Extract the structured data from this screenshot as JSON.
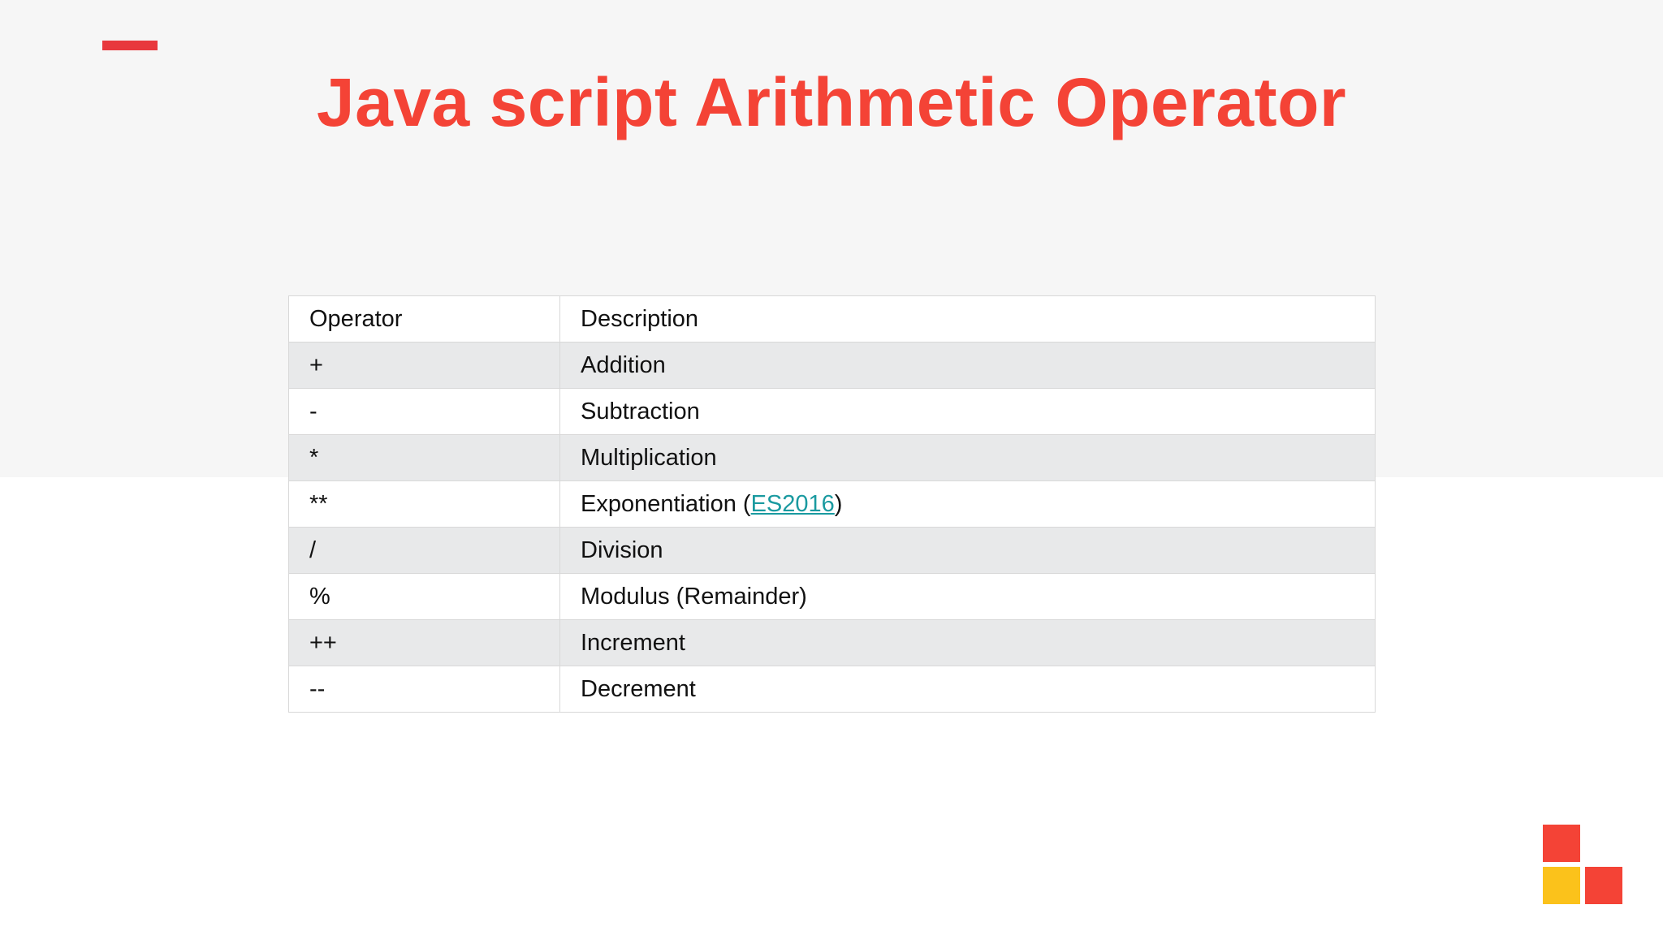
{
  "slide": {
    "title": "Java script Arithmetic Operator"
  },
  "table": {
    "headers": [
      "Operator",
      "Description"
    ],
    "rows": [
      {
        "operator": "+",
        "description": "Addition"
      },
      {
        "operator": "-",
        "description": "Subtraction"
      },
      {
        "operator": "*",
        "description": "Multiplication"
      },
      {
        "operator": "**",
        "description_prefix": "Exponentiation (",
        "description_link": "ES2016",
        "description_suffix": ")"
      },
      {
        "operator": "/",
        "description": "Division"
      },
      {
        "operator": "%",
        "description": "Modulus (Remainder)"
      },
      {
        "operator": "++",
        "description": "Increment"
      },
      {
        "operator": "--",
        "description": "Decrement"
      }
    ]
  },
  "colors": {
    "accent": "#f44336",
    "accent_bar": "#e8383d",
    "logo_yellow": "#fbc21b",
    "link": "#1a9aa0"
  }
}
